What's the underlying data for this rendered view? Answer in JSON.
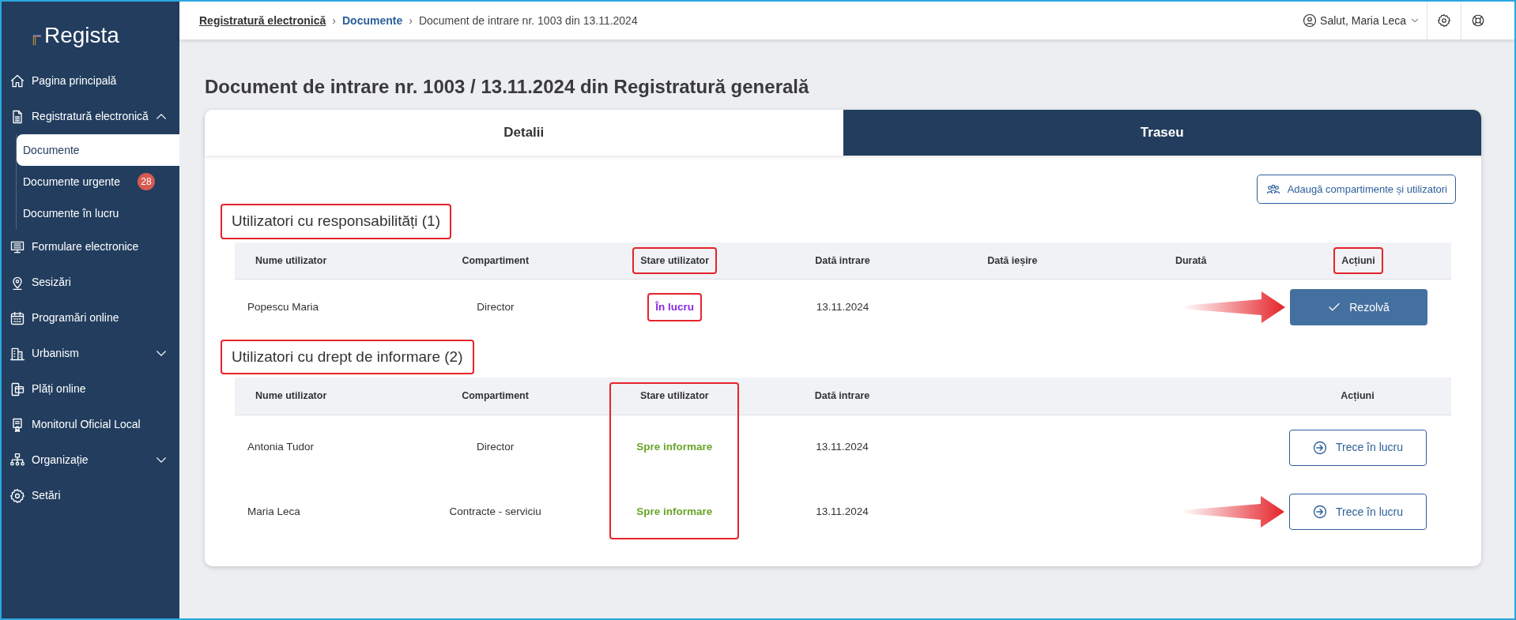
{
  "sidebar": {
    "logo": "Regista",
    "items": [
      {
        "label": "Pagina principală",
        "kind": "link"
      },
      {
        "label": "Registratură electronică",
        "kind": "group",
        "expanded": true,
        "children": [
          {
            "label": "Documente",
            "selected": true
          },
          {
            "label": "Documente urgente",
            "selected": false,
            "badge": "28"
          },
          {
            "label": "Documente în lucru",
            "selected": false
          }
        ]
      },
      {
        "label": "Formulare electronice",
        "kind": "link"
      },
      {
        "label": "Sesizări",
        "kind": "link"
      },
      {
        "label": "Programări online",
        "kind": "link"
      },
      {
        "label": "Urbanism",
        "kind": "group",
        "expanded": false
      },
      {
        "label": "Plăți online",
        "kind": "link"
      },
      {
        "label": "Monitorul Oficial Local",
        "kind": "link"
      },
      {
        "label": "Organizație",
        "kind": "group",
        "expanded": false
      },
      {
        "label": "Setări",
        "kind": "link"
      }
    ]
  },
  "header": {
    "separator": "›",
    "breadcrumbs": [
      {
        "label": "Registratură electronică",
        "kind": "root"
      },
      {
        "label": "Documente",
        "kind": "link"
      },
      {
        "label": "Document de intrare nr. 1003 din 13.11.2024",
        "kind": "current"
      }
    ],
    "user": "Salut, Maria Leca"
  },
  "title": "Document de intrare nr. 1003 / 13.11.2024 din Registratură generală",
  "tabs": [
    {
      "label": "Detalii",
      "selected": false
    },
    {
      "label": "Traseu",
      "selected": true
    }
  ],
  "add_button": "Adaugă compartimente și utilizatori",
  "sections": [
    {
      "title": "Utilizatori cu responsabilități (1)",
      "highlighted": true,
      "columns": [
        {
          "label": "Nume utilizator",
          "highlighted": false,
          "column_highlighted": false
        },
        {
          "label": "Compartiment",
          "highlighted": false,
          "column_highlighted": false
        },
        {
          "label": "Stare utilizator",
          "highlighted": true,
          "column_highlighted": false
        },
        {
          "label": "Dată intrare",
          "highlighted": false,
          "column_highlighted": false
        },
        {
          "label": "Dată ieșire",
          "highlighted": false,
          "column_highlighted": false
        },
        {
          "label": "Durată",
          "highlighted": false,
          "column_highlighted": false
        },
        {
          "label": "Acțiuni",
          "highlighted": true,
          "column_highlighted": false
        }
      ],
      "rows": [
        {
          "name": "Popescu Maria",
          "department": "Director",
          "status": {
            "label": "În lucru",
            "kind": "working",
            "highlighted": true
          },
          "date_in": "13.11.2024",
          "action": {
            "label": "Rezolvă",
            "kind": "resolve"
          },
          "arrow": true
        }
      ]
    },
    {
      "title": "Utilizatori cu drept de informare (2)",
      "highlighted": true,
      "columns": [
        {
          "label": "Nume utilizator",
          "highlighted": false,
          "column_highlighted": false
        },
        {
          "label": "Compartiment",
          "highlighted": false,
          "column_highlighted": false
        },
        {
          "label": "Stare utilizator",
          "highlighted": false,
          "column_highlighted": true
        },
        {
          "label": "Dată intrare",
          "highlighted": false,
          "column_highlighted": false
        },
        {
          "label": "Acțiuni",
          "highlighted": false,
          "column_highlighted": false
        }
      ],
      "rows": [
        {
          "name": "Antonia Tudor",
          "department": "Director",
          "status": {
            "label": "Spre informare",
            "kind": "info",
            "highlighted": false
          },
          "date_in": "13.11.2024",
          "action": {
            "label": "Trece în lucru",
            "kind": "take"
          },
          "arrow": false
        },
        {
          "name": "Maria Leca",
          "department": "Contracte - serviciu",
          "status": {
            "label": "Spre informare",
            "kind": "info",
            "highlighted": false
          },
          "date_in": "13.11.2024",
          "action": {
            "label": "Trece în lucru",
            "kind": "take"
          },
          "arrow": true
        }
      ]
    }
  ]
}
